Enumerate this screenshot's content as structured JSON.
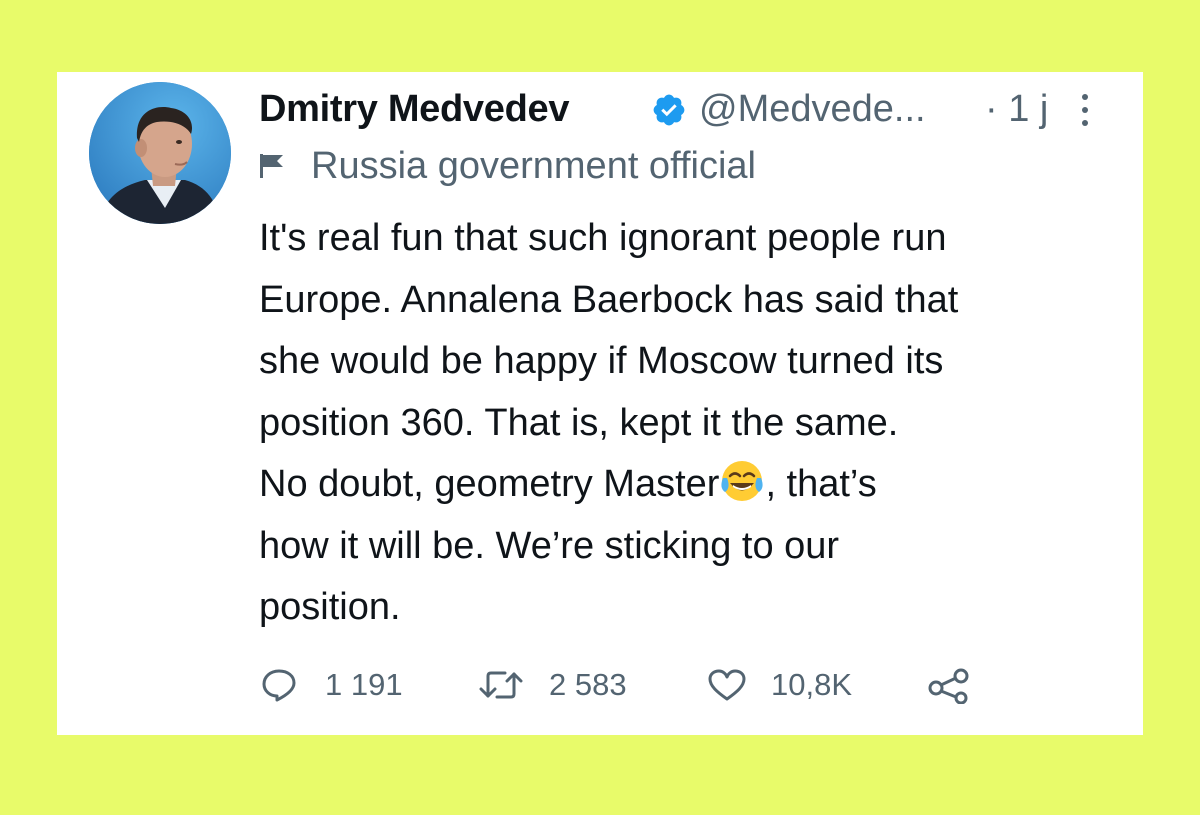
{
  "tweet": {
    "author_name": "Dmitry Medvedev",
    "handle": "@Medvede...",
    "time": "· 1 j",
    "label": "Russia government official",
    "text_lines": {
      "l1": "It's real fun that such ignorant people run",
      "l2": "Europe. Annalena Baerbock has said that",
      "l3": "she would be happy if Moscow turned its",
      "l4": "position 360. That is, kept it the same.",
      "l5_before_emoji": "No doubt, geometry Master",
      "l5_after_emoji": ", that’s",
      "l6": "how it will be. We’re sticking to our",
      "l7": "position."
    },
    "emoji": "face-with-tears-of-joy"
  },
  "actions": {
    "reply_count": "1 191",
    "retweet_count": "2 583",
    "like_count": "10,8K"
  },
  "colors": {
    "background": "#e8fb6a",
    "card": "#ffffff",
    "text": "#0f1419",
    "secondary": "#536471",
    "verified": "#1d9bf0"
  }
}
